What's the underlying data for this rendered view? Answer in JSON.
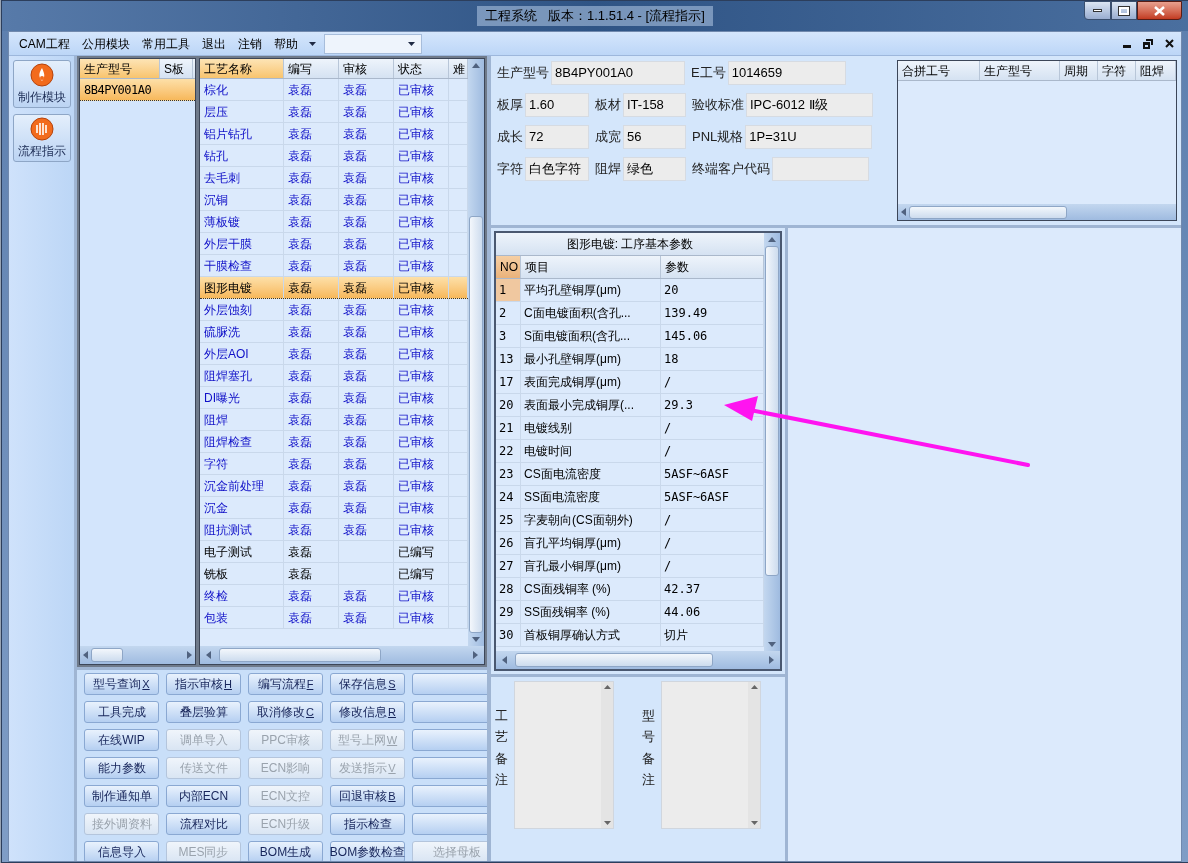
{
  "window": {
    "title": "工程系统   版本：1.1.51.4 - [流程指示]"
  },
  "menu": [
    {
      "label": "CAM工程"
    },
    {
      "label": "公用模块"
    },
    {
      "label": "常用工具"
    },
    {
      "label": "退出"
    },
    {
      "label": "注销"
    },
    {
      "label": "帮助"
    }
  ],
  "nav": [
    {
      "label": "制作模块",
      "kind": "flame"
    },
    {
      "label": "流程指示",
      "kind": "bars"
    }
  ],
  "model_list": {
    "columns": [
      "生产型号",
      "S板"
    ],
    "rows": [
      {
        "cells": [
          "8B4PY001A0",
          ""
        ],
        "selected": true
      }
    ]
  },
  "process_table": {
    "columns": [
      "工艺名称",
      "编写",
      "审核",
      "状态",
      "难"
    ],
    "rows": [
      {
        "cells": [
          "棕化",
          "袁磊",
          "袁磊",
          "已审核"
        ],
        "reviewed": true,
        "selected": false
      },
      {
        "cells": [
          "层压",
          "袁磊",
          "袁磊",
          "已审核"
        ],
        "reviewed": true,
        "selected": false
      },
      {
        "cells": [
          "铝片钻孔",
          "袁磊",
          "袁磊",
          "已审核"
        ],
        "reviewed": true,
        "selected": false
      },
      {
        "cells": [
          "钻孔",
          "袁磊",
          "袁磊",
          "已审核"
        ],
        "reviewed": true,
        "selected": false
      },
      {
        "cells": [
          "去毛刺",
          "袁磊",
          "袁磊",
          "已审核"
        ],
        "reviewed": true,
        "selected": false
      },
      {
        "cells": [
          "沉铜",
          "袁磊",
          "袁磊",
          "已审核"
        ],
        "reviewed": true,
        "selected": false
      },
      {
        "cells": [
          "薄板镀",
          "袁磊",
          "袁磊",
          "已审核"
        ],
        "reviewed": true,
        "selected": false
      },
      {
        "cells": [
          "外层干膜",
          "袁磊",
          "袁磊",
          "已审核"
        ],
        "reviewed": true,
        "selected": false
      },
      {
        "cells": [
          "干膜检查",
          "袁磊",
          "袁磊",
          "已审核"
        ],
        "reviewed": true,
        "selected": false
      },
      {
        "cells": [
          "图形电镀",
          "袁磊",
          "袁磊",
          "已审核"
        ],
        "reviewed": true,
        "selected": true
      },
      {
        "cells": [
          "外层蚀刻",
          "袁磊",
          "袁磊",
          "已审核"
        ],
        "reviewed": true,
        "selected": false
      },
      {
        "cells": [
          "硫脲洗",
          "袁磊",
          "袁磊",
          "已审核"
        ],
        "reviewed": true,
        "selected": false
      },
      {
        "cells": [
          "外层AOI",
          "袁磊",
          "袁磊",
          "已审核"
        ],
        "reviewed": true,
        "selected": false
      },
      {
        "cells": [
          "阻焊塞孔",
          "袁磊",
          "袁磊",
          "已审核"
        ],
        "reviewed": true,
        "selected": false
      },
      {
        "cells": [
          "DI曝光",
          "袁磊",
          "袁磊",
          "已审核"
        ],
        "reviewed": true,
        "selected": false
      },
      {
        "cells": [
          "阻焊",
          "袁磊",
          "袁磊",
          "已审核"
        ],
        "reviewed": true,
        "selected": false
      },
      {
        "cells": [
          "阻焊检查",
          "袁磊",
          "袁磊",
          "已审核"
        ],
        "reviewed": true,
        "selected": false
      },
      {
        "cells": [
          "字符",
          "袁磊",
          "袁磊",
          "已审核"
        ],
        "reviewed": true,
        "selected": false
      },
      {
        "cells": [
          "沉金前处理",
          "袁磊",
          "袁磊",
          "已审核"
        ],
        "reviewed": true,
        "selected": false
      },
      {
        "cells": [
          "沉金",
          "袁磊",
          "袁磊",
          "已审核"
        ],
        "reviewed": true,
        "selected": false
      },
      {
        "cells": [
          "阻抗测试",
          "袁磊",
          "袁磊",
          "已审核"
        ],
        "reviewed": true,
        "selected": false
      },
      {
        "cells": [
          "电子测试",
          "袁磊",
          "",
          "已编写"
        ],
        "reviewed": false,
        "selected": false
      },
      {
        "cells": [
          "铣板",
          "袁磊",
          "",
          "已编写"
        ],
        "reviewed": false,
        "selected": false
      },
      {
        "cells": [
          "终检",
          "袁磊",
          "袁磊",
          "已审核"
        ],
        "reviewed": true,
        "selected": false
      },
      {
        "cells": [
          "包装",
          "袁磊",
          "袁磊",
          "已审核"
        ],
        "reviewed": true,
        "selected": false
      }
    ]
  },
  "buttons": [
    {
      "label": "型号查询",
      "mnemonic": "X",
      "disabled": false
    },
    {
      "label": "指示审核",
      "mnemonic": "H",
      "disabled": false
    },
    {
      "label": "编写流程",
      "mnemonic": "F",
      "disabled": false
    },
    {
      "label": "保存信息",
      "mnemonic": "S",
      "disabled": false
    },
    {
      "disabled": false
    },
    {
      "label": "工具完成",
      "disabled": false
    },
    {
      "label": "叠层验算",
      "disabled": false
    },
    {
      "label": "取消修改",
      "mnemonic": "C",
      "disabled": false
    },
    {
      "label": "修改信息",
      "mnemonic": "R",
      "disabled": false
    },
    {
      "disabled": false
    },
    {
      "label": "在线WIP",
      "disabled": false
    },
    {
      "label": "调单导入",
      "disabled": true
    },
    {
      "label": "PPC审核",
      "disabled": true
    },
    {
      "label": "型号上网",
      "mnemonic": "W",
      "disabled": true
    },
    {
      "disabled": false
    },
    {
      "label": "能力参数",
      "disabled": false
    },
    {
      "label": "传送文件",
      "disabled": true
    },
    {
      "label": "ECN影响",
      "disabled": true
    },
    {
      "label": "发送指示",
      "mnemonic": "V",
      "disabled": true
    },
    {
      "disabled": false
    },
    {
      "label": "制作通知单",
      "disabled": false
    },
    {
      "label": "内部ECN",
      "disabled": false
    },
    {
      "label": "ECN文控",
      "disabled": true
    },
    {
      "label": "回退审核",
      "mnemonic": "B",
      "disabled": false
    },
    {
      "disabled": false
    },
    {
      "label": "接外调资料",
      "disabled": true
    },
    {
      "label": "流程对比",
      "disabled": false
    },
    {
      "label": "ECN升级",
      "disabled": true
    },
    {
      "label": "指示检查",
      "disabled": false
    },
    {
      "disabled": false
    },
    {
      "label": "信息导入",
      "disabled": false
    },
    {
      "label": "MES同步",
      "disabled": true
    },
    {
      "label": "BOM生成",
      "disabled": false
    },
    {
      "label": "BOM参数检查",
      "disabled": false
    },
    {
      "label": "选择母板",
      "disabled": true
    }
  ],
  "info": [
    [
      {
        "label": "生产型号",
        "value": "8B4PY001A0"
      },
      {
        "label": "E工号",
        "value": "1014659"
      }
    ],
    [
      {
        "label": "板厚",
        "value": "1.60"
      },
      {
        "label": "板材",
        "value": "IT-158"
      },
      {
        "label": "验收标准",
        "value": "IPC-6012 Ⅱ级"
      }
    ],
    [
      {
        "label": "成长",
        "value": "72"
      },
      {
        "label": "成宽",
        "value": "56"
      },
      {
        "label": "PNL规格",
        "value": "1P=31U"
      }
    ],
    [
      {
        "label": "字符",
        "value": "白色字符"
      },
      {
        "label": "阻焊",
        "value": "绿色"
      },
      {
        "label": "终端客户代码"
      }
    ]
  ],
  "merge_table": {
    "columns": [
      "合拼工号",
      "生产型号",
      "周期",
      "字符",
      "阻焊"
    ]
  },
  "params": {
    "title": "图形电镀: 工序基本参数",
    "columns": [
      "NO",
      "项目",
      "参数"
    ],
    "rows": [
      {
        "cells": [
          "1",
          "平均孔壁铜厚(μm)",
          "20"
        ],
        "selected": true
      },
      {
        "cells": [
          "2",
          "C面电镀面积(含孔...",
          "139.49"
        ],
        "selected": false
      },
      {
        "cells": [
          "3",
          "S面电镀面积(含孔...",
          "145.06"
        ],
        "selected": false
      },
      {
        "cells": [
          "13",
          "最小孔壁铜厚(μm)",
          "18"
        ],
        "selected": false
      },
      {
        "cells": [
          "17",
          "表面完成铜厚(μm)",
          "/"
        ],
        "selected": false
      },
      {
        "cells": [
          "20",
          "表面最小完成铜厚(...",
          "29.3"
        ],
        "selected": false
      },
      {
        "cells": [
          "21",
          "电镀线别",
          "/"
        ],
        "selected": false
      },
      {
        "cells": [
          "22",
          "电镀时间",
          "/"
        ],
        "selected": false
      },
      {
        "cells": [
          "23",
          "CS面电流密度",
          "5ASF~6ASF"
        ],
        "selected": false
      },
      {
        "cells": [
          "24",
          "SS面电流密度",
          "5ASF~6ASF"
        ],
        "selected": false
      },
      {
        "cells": [
          "25",
          "字麦朝向(CS面朝外)",
          "/"
        ],
        "selected": false
      },
      {
        "cells": [
          "26",
          "盲孔平均铜厚(μm)",
          "/"
        ],
        "selected": false
      },
      {
        "cells": [
          "27",
          "盲孔最小铜厚(μm)",
          "/"
        ],
        "selected": false
      },
      {
        "cells": [
          "28",
          "CS面残铜率 (%)",
          "42.37"
        ],
        "selected": false
      },
      {
        "cells": [
          "29",
          "SS面残铜率 (%)",
          "44.06"
        ],
        "selected": false
      },
      {
        "cells": [
          "30",
          "首板铜厚确认方式",
          "切片"
        ],
        "selected": false
      }
    ]
  },
  "remarks": [
    {
      "label": "工艺备注"
    },
    {
      "label": "型号备注"
    }
  ]
}
